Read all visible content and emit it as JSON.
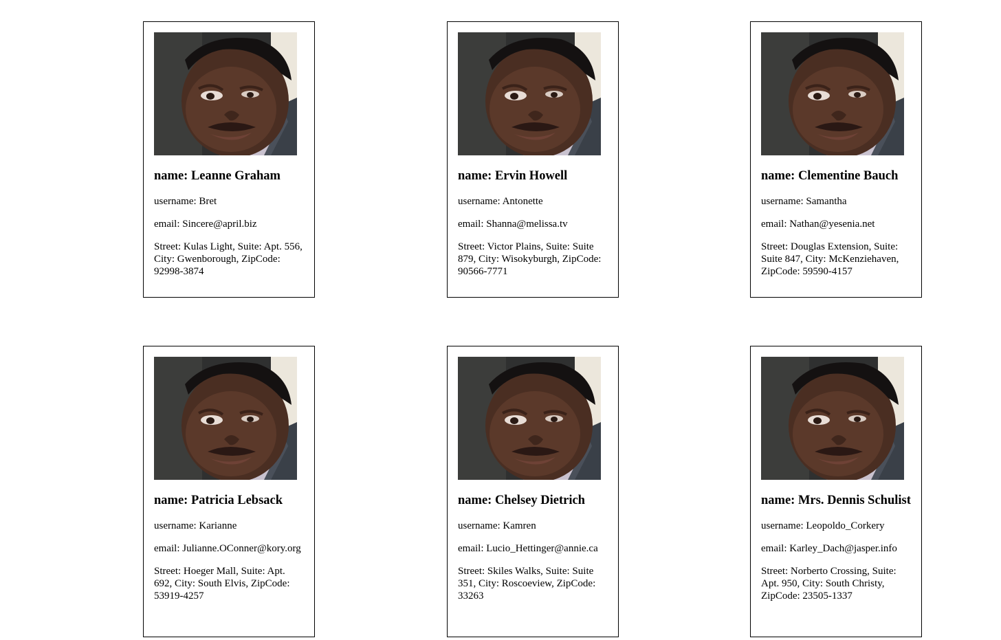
{
  "users": [
    {
      "name": "name: Leanne Graham",
      "username": "username: Bret",
      "email": "email: Sincere@april.biz",
      "address": "Street: Kulas Light, Suite: Apt. 556, City: Gwenborough, ZipCode: 92998-3874"
    },
    {
      "name": "name: Ervin Howell",
      "username": "username: Antonette",
      "email": "email: Shanna@melissa.tv",
      "address": "Street: Victor Plains, Suite: Suite 879, City: Wisokyburgh, ZipCode: 90566-7771"
    },
    {
      "name": "name: Clementine Bauch",
      "username": "username: Samantha",
      "email": "email: Nathan@yesenia.net",
      "address": "Street: Douglas Extension, Suite: Suite 847, City: McKenziehaven, ZipCode: 59590-4157"
    },
    {
      "name": "name: Patricia Lebsack",
      "username": "username: Karianne",
      "email": "email: Julianne.OConner@kory.org",
      "address": "Street: Hoeger Mall, Suite: Apt. 692, City: South Elvis, ZipCode: 53919-4257"
    },
    {
      "name": "name: Chelsey Dietrich",
      "username": "username: Kamren",
      "email": "email: Lucio_Hettinger@annie.ca",
      "address": "Street: Skiles Walks, Suite: Suite 351, City: Roscoeview, ZipCode: 33263"
    },
    {
      "name": "name: Mrs. Dennis Schulist",
      "username": "username: Leopoldo_Corkery",
      "email": "email: Karley_Dach@jasper.info",
      "address": "Street: Norberto Crossing, Suite: Apt. 950, City: South Christy, ZipCode: 23505-1337"
    }
  ]
}
